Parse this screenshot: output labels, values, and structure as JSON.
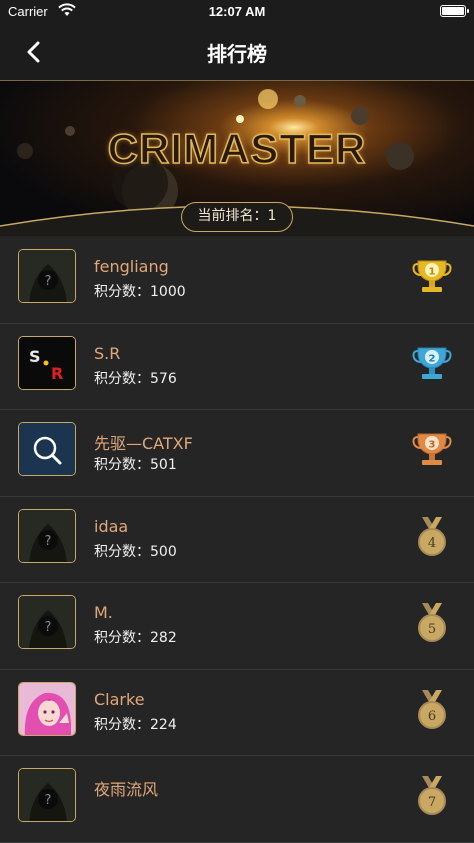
{
  "status_bar": {
    "carrier": "Carrier",
    "time": "12:07 AM"
  },
  "nav": {
    "title": "排行榜",
    "back_icon": "chevron-left-icon"
  },
  "banner": {
    "logo_text": "CRIMASTER",
    "current_rank": "当前排名：1"
  },
  "colors": {
    "accent_gold": "#c9a864",
    "name_color": "#e0a87a",
    "background": "#212121"
  },
  "score_prefix": "积分数：",
  "ranking": [
    {
      "name": "fengliang",
      "score": "1000",
      "rank": "1",
      "avatar": "hooded-figure"
    },
    {
      "name": "S.R",
      "score": "576",
      "rank": "2",
      "avatar": "sr-logo"
    },
    {
      "name": "先驱—CATXF",
      "score": "501",
      "rank": "3",
      "avatar": "search-logo"
    },
    {
      "name": "idaa",
      "score": "500",
      "rank": "4",
      "avatar": "hooded-figure"
    },
    {
      "name": "M.",
      "score": "282",
      "rank": "5",
      "avatar": "hooded-figure"
    },
    {
      "name": "Clarke",
      "score": "224",
      "rank": "6",
      "avatar": "anime-girl"
    },
    {
      "name": "夜雨流风",
      "score": "",
      "rank": "7",
      "avatar": "hooded-figure"
    }
  ]
}
